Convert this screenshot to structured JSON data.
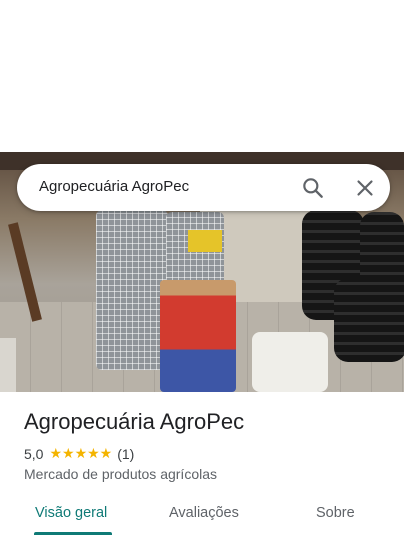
{
  "search": {
    "query": "Agropecuária AgroPec"
  },
  "place": {
    "name": "Agropecuária AgroPec",
    "rating": "5,0",
    "stars": "★★★★★",
    "review_count": "(1)",
    "category": "Mercado de produtos agrícolas"
  },
  "tabs": [
    {
      "label": "Visão geral",
      "selected": true
    },
    {
      "label": "Avaliações",
      "selected": false
    },
    {
      "label": "Sobre",
      "selected": false
    }
  ],
  "colors": {
    "accent": "#0f7a76",
    "star": "#f4b400"
  },
  "icons": {
    "search": "search-icon",
    "close": "close-icon"
  }
}
